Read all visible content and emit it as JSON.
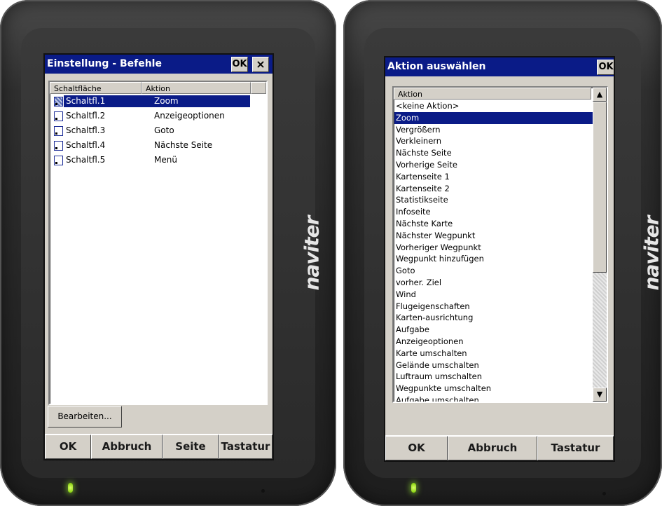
{
  "brand": "naviter",
  "left": {
    "title": "Einstellung - Befehle",
    "ok_label": "OK",
    "close_label": "×",
    "columns": [
      "Schaltfläche",
      "Aktion"
    ],
    "rows": [
      {
        "button": "Schaltfl.1",
        "action": "Zoom"
      },
      {
        "button": "Schaltfl.2",
        "action": "Anzeigeoptionen"
      },
      {
        "button": "Schaltfl.3",
        "action": "Goto"
      },
      {
        "button": "Schaltfl.4",
        "action": "Nächste Seite"
      },
      {
        "button": "Schaltfl.5",
        "action": "Menü"
      }
    ],
    "edit_button": "Bearbeiten...",
    "bottom": [
      "OK",
      "Abbruch",
      "Seite",
      "Tastatur"
    ]
  },
  "right": {
    "title": "Aktion auswählen",
    "ok_label": "OK",
    "column": "Aktion",
    "items": [
      "<keine Aktion>",
      "Zoom",
      "Vergrößern",
      "Verkleinern",
      "Nächste Seite",
      "Vorherige Seite",
      "Kartenseite 1",
      "Kartenseite 2",
      "Statistikseite",
      "Infoseite",
      "Nächste Karte",
      "Nächster Wegpunkt",
      "Vorheriger Wegpunkt",
      "Wegpunkt hinzufügen",
      "Goto",
      "vorher. Ziel",
      "Wind",
      "Flugeigenschaften",
      "Karten-ausrichtung",
      "Aufgabe",
      "Anzeigeoptionen",
      "Karte umschalten",
      "Gelände umschalten",
      "Luftraum umschalten",
      "Wegpunkte umschalten",
      "Aufgabe umschalten"
    ],
    "selected_index": 1,
    "bottom": [
      "OK",
      "Abbruch",
      "Tastatur"
    ]
  }
}
